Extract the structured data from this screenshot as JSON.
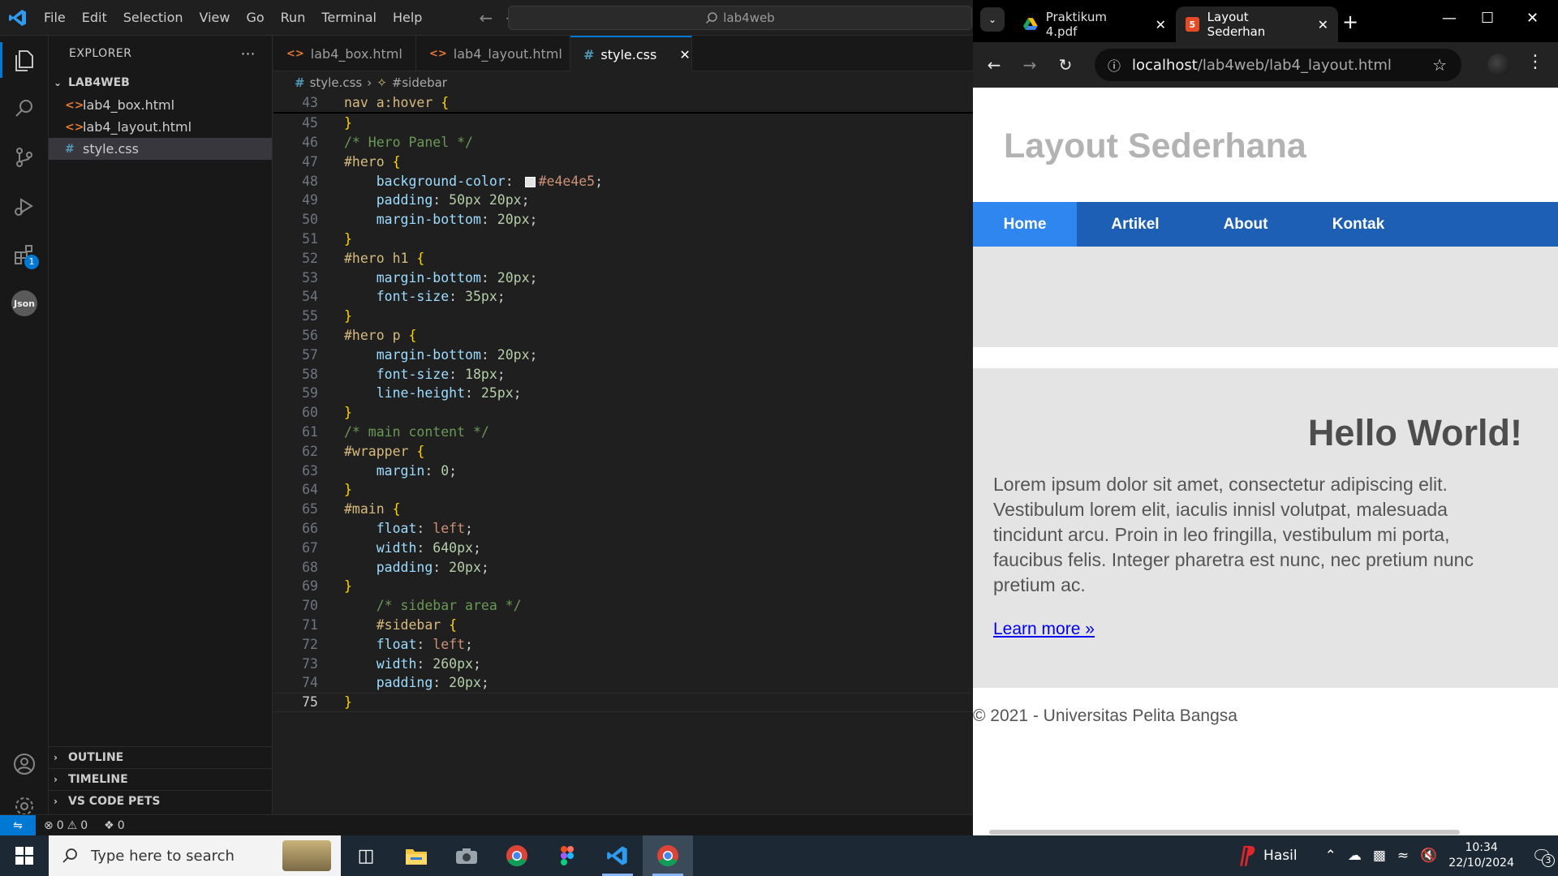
{
  "vscode": {
    "menu": [
      "File",
      "Edit",
      "Selection",
      "View",
      "Go",
      "Run",
      "Terminal",
      "Help"
    ],
    "search_text": "lab4web",
    "explorer_title": "EXPLORER",
    "folder": "LAB4WEB",
    "files": [
      "lab4_box.html",
      "lab4_layout.html",
      "style.css"
    ],
    "sections": [
      "OUTLINE",
      "TIMELINE",
      "VS CODE PETS"
    ],
    "tabs": [
      "lab4_box.html",
      "lab4_layout.html",
      "style.css"
    ],
    "breadcrumb": [
      "style.css",
      "#sidebar"
    ],
    "extensions_badge": "1",
    "code": [
      {
        "n": "43",
        "html": "<span class='sel-c'>nav a:hover</span> <span class='brace'>{</span>"
      },
      {
        "n": "45",
        "html": "<span class='brace'>}</span>"
      },
      {
        "n": "46",
        "html": "<span class='cmt'>/* Hero Panel */</span>"
      },
      {
        "n": "47",
        "html": "<span class='sel-c'>#hero</span> <span class='brace'>{</span>"
      },
      {
        "n": "48",
        "html": "    <span class='prop'>background-color</span>: <span class='swatch'></span><span class='val'>#e4e4e5</span>;"
      },
      {
        "n": "49",
        "html": "    <span class='prop'>padding</span>: <span class='num'>50px</span> <span class='num'>20px</span>;"
      },
      {
        "n": "50",
        "html": "    <span class='prop'>margin-bottom</span>: <span class='num'>20px</span>;"
      },
      {
        "n": "51",
        "html": "<span class='brace'>}</span>"
      },
      {
        "n": "52",
        "html": "<span class='sel-c'>#hero h1</span> <span class='brace'>{</span>"
      },
      {
        "n": "53",
        "html": "    <span class='prop'>margin-bottom</span>: <span class='num'>20px</span>;"
      },
      {
        "n": "54",
        "html": "    <span class='prop'>font-size</span>: <span class='num'>35px</span>;"
      },
      {
        "n": "55",
        "html": "<span class='brace'>}</span>"
      },
      {
        "n": "56",
        "html": "<span class='sel-c'>#hero p</span> <span class='brace'>{</span>"
      },
      {
        "n": "57",
        "html": "    <span class='prop'>margin-bottom</span>: <span class='num'>20px</span>;"
      },
      {
        "n": "58",
        "html": "    <span class='prop'>font-size</span>: <span class='num'>18px</span>;"
      },
      {
        "n": "59",
        "html": "    <span class='prop'>line-height</span>: <span class='num'>25px</span>;"
      },
      {
        "n": "60",
        "html": "<span class='brace'>}</span>"
      },
      {
        "n": "61",
        "html": "<span class='cmt'>/* main content */</span>"
      },
      {
        "n": "62",
        "html": "<span class='sel-c'>#wrapper</span> <span class='brace'>{</span>"
      },
      {
        "n": "63",
        "html": "    <span class='prop'>margin</span>: <span class='num'>0</span>;"
      },
      {
        "n": "64",
        "html": "<span class='brace'>}</span>"
      },
      {
        "n": "65",
        "html": "<span class='sel-c'>#main</span> <span class='brace'>{</span>"
      },
      {
        "n": "66",
        "html": "    <span class='prop'>float</span>: <span class='val'>left</span>;"
      },
      {
        "n": "67",
        "html": "    <span class='prop'>width</span>: <span class='num'>640px</span>;"
      },
      {
        "n": "68",
        "html": "    <span class='prop'>padding</span>: <span class='num'>20px</span>;"
      },
      {
        "n": "69",
        "html": "<span class='brace'>}</span>"
      },
      {
        "n": "70",
        "html": "    <span class='cmt'>/* sidebar area */</span>"
      },
      {
        "n": "71",
        "html": "    <span class='sel-c'>#sidebar</span> <span class='brace'>{</span>"
      },
      {
        "n": "72",
        "html": "    <span class='prop'>float</span>: <span class='val'>left</span>;"
      },
      {
        "n": "73",
        "html": "    <span class='prop'>width</span>: <span class='num'>260px</span>;"
      },
      {
        "n": "74",
        "html": "    <span class='prop'>padding</span>: <span class='num'>20px</span>;"
      },
      {
        "n": "75",
        "html": "<span class='brace'>}</span>"
      }
    ],
    "status": {
      "errors": "0",
      "warnings": "0",
      "ports": "0"
    }
  },
  "chrome": {
    "tabs": [
      "Praktikum 4.pdf",
      "Layout Sederhan"
    ],
    "url_host": "localhost",
    "url_path": "/lab4web/lab4_layout.html"
  },
  "site": {
    "title": "Layout Sederhana",
    "nav": [
      "Home",
      "Artikel",
      "About",
      "Kontak"
    ],
    "hero_title": "Hello World!",
    "hero_text": "Lorem ipsum dolor sit amet, consectetur adipiscing elit. Vestibulum lorem elit, iaculis innisl volutpat, malesuada tincidunt arcu. Proin in leo fringilla, vestibulum mi porta, faucibus felis. Integer pharetra est nunc, nec pretium nunc pretium ac.",
    "learn_more": "Learn more »",
    "footer": "© 2021 - Universitas Pelita Bangsa"
  },
  "taskbar": {
    "search_placeholder": "Type here to search",
    "tray_app": "Hasil",
    "time": "10:34",
    "date": "22/10/2024",
    "notifications": "3"
  },
  "colors": {
    "hero_bg": "#e4e4e5",
    "nav_bg": "#1c5fb5",
    "nav_active": "#2e86ee",
    "vscode_accent": "#0078d4"
  }
}
